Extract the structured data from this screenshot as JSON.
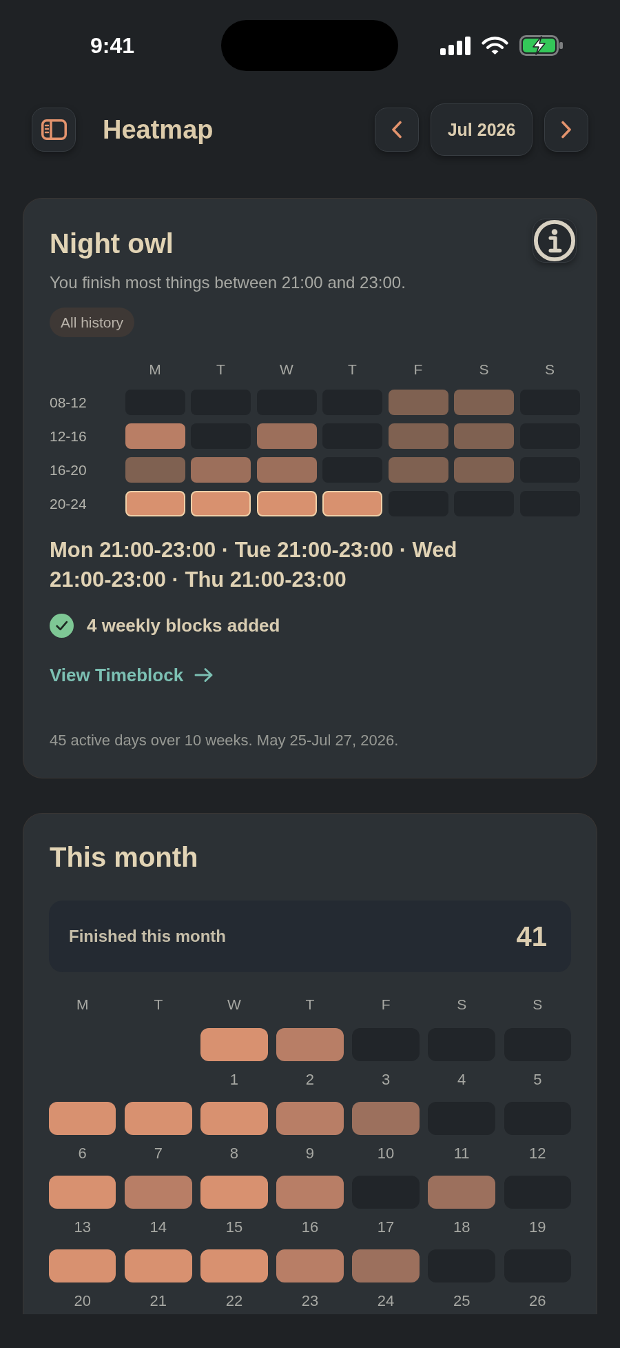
{
  "status_bar": {
    "time": "9:41"
  },
  "header": {
    "title": "Heatmap",
    "month": "Jul 2026"
  },
  "pattern_card": {
    "title": "Night owl",
    "subtitle": "You finish most things between 21:00 and 23:00.",
    "filter_chip": "All history",
    "heatmap": {
      "days": [
        "M",
        "T",
        "W",
        "T",
        "F",
        "S",
        "S"
      ],
      "rows": [
        {
          "label": "08-12",
          "cells": [
            {
              "color": "#212529",
              "highlighted": false
            },
            {
              "color": "#212529",
              "highlighted": false
            },
            {
              "color": "#212529",
              "highlighted": false
            },
            {
              "color": "#212529",
              "highlighted": false
            },
            {
              "color": "#7f6151",
              "highlighted": false
            },
            {
              "color": "#7f6151",
              "highlighted": false
            },
            {
              "color": "#212529",
              "highlighted": false
            }
          ]
        },
        {
          "label": "12-16",
          "cells": [
            {
              "color": "#b97e65",
              "highlighted": false
            },
            {
              "color": "#212529",
              "highlighted": false
            },
            {
              "color": "#9c6f5b",
              "highlighted": false
            },
            {
              "color": "#212529",
              "highlighted": false
            },
            {
              "color": "#7f6151",
              "highlighted": false
            },
            {
              "color": "#7f6151",
              "highlighted": false
            },
            {
              "color": "#212529",
              "highlighted": false
            }
          ]
        },
        {
          "label": "16-20",
          "cells": [
            {
              "color": "#7f6151",
              "highlighted": false
            },
            {
              "color": "#9c6f5b",
              "highlighted": false
            },
            {
              "color": "#9c6f5b",
              "highlighted": false
            },
            {
              "color": "#212529",
              "highlighted": false
            },
            {
              "color": "#7f6151",
              "highlighted": false
            },
            {
              "color": "#7f6151",
              "highlighted": false
            },
            {
              "color": "#212529",
              "highlighted": false
            }
          ]
        },
        {
          "label": "20-24",
          "cells": [
            {
              "color": "#d8916f",
              "highlighted": true
            },
            {
              "color": "#d8916f",
              "highlighted": true
            },
            {
              "color": "#d8916f",
              "highlighted": true
            },
            {
              "color": "#d8916f",
              "highlighted": true
            },
            {
              "color": "#212529",
              "highlighted": false
            },
            {
              "color": "#212529",
              "highlighted": false
            },
            {
              "color": "#212529",
              "highlighted": false
            }
          ]
        }
      ]
    },
    "summary": "Mon 21:00-23:00 · Tue 21:00-23:00 · Wed 21:00-23:00 · Thu 21:00-23:00",
    "status": "4 weekly blocks added",
    "link": "View Timeblock",
    "footnote": "45 active days over 10 weeks. May 25-Jul 27, 2026."
  },
  "month_card": {
    "title": "This month",
    "stat": {
      "label": "Finished this month",
      "value": "41"
    },
    "weekdays": [
      "M",
      "T",
      "W",
      "T",
      "F",
      "S",
      "S"
    ],
    "days": [
      {
        "kind": "blank"
      },
      {
        "kind": "blank"
      },
      {
        "kind": "day",
        "label": "1",
        "color": "#d89170"
      },
      {
        "kind": "day",
        "label": "2",
        "color": "#b87e66"
      },
      {
        "kind": "day",
        "label": "3",
        "color": "#212529"
      },
      {
        "kind": "day",
        "label": "4",
        "color": "#212529"
      },
      {
        "kind": "day",
        "label": "5",
        "color": "#212529"
      },
      {
        "kind": "day",
        "label": "6",
        "color": "#d89170"
      },
      {
        "kind": "day",
        "label": "7",
        "color": "#d89170"
      },
      {
        "kind": "day",
        "label": "8",
        "color": "#d89170"
      },
      {
        "kind": "day",
        "label": "9",
        "color": "#b87e66"
      },
      {
        "kind": "day",
        "label": "10",
        "color": "#9c705d"
      },
      {
        "kind": "day",
        "label": "11",
        "color": "#212529"
      },
      {
        "kind": "day",
        "label": "12",
        "color": "#212529"
      },
      {
        "kind": "day",
        "label": "13",
        "color": "#d89170"
      },
      {
        "kind": "day",
        "label": "14",
        "color": "#b87e66"
      },
      {
        "kind": "day",
        "label": "15",
        "color": "#d89170"
      },
      {
        "kind": "day",
        "label": "16",
        "color": "#b87e66"
      },
      {
        "kind": "day",
        "label": "17",
        "color": "#212529"
      },
      {
        "kind": "day",
        "label": "18",
        "color": "#9c705d"
      },
      {
        "kind": "day",
        "label": "19",
        "color": "#212529"
      },
      {
        "kind": "day",
        "label": "20",
        "color": "#d89170"
      },
      {
        "kind": "day",
        "label": "21",
        "color": "#d89170"
      },
      {
        "kind": "day",
        "label": "22",
        "color": "#d89170"
      },
      {
        "kind": "day",
        "label": "23",
        "color": "#b87e66"
      },
      {
        "kind": "day",
        "label": "24",
        "color": "#9c705d"
      },
      {
        "kind": "day",
        "label": "25",
        "color": "#212529"
      },
      {
        "kind": "day",
        "label": "26",
        "color": "#212529"
      }
    ]
  }
}
